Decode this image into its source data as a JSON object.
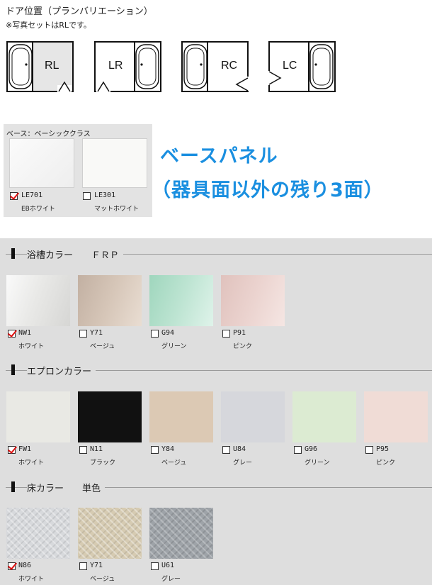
{
  "door": {
    "title": "ドア位置（プランバリエーション）",
    "note": "※写真セットはRLです。",
    "plans": [
      "RL",
      "LR",
      "RC",
      "LC"
    ]
  },
  "base": {
    "subtitle": "ベース：ベーシッククラス",
    "heading_line1": "ベースパネル",
    "heading_line2": "（器具面以外の残り3面）",
    "accent_color": "#1a8fe0",
    "items": [
      {
        "code": "LE701",
        "name": "EBホワイト",
        "checked": true,
        "color": "#f4f4f4"
      },
      {
        "code": "LE301",
        "name": "マットホワイト",
        "checked": false,
        "color": "#f9f9f7"
      }
    ]
  },
  "tub": {
    "label": "浴槽カラー　　ＦＲＰ",
    "items": [
      {
        "code": "NW1",
        "name": "ホワイト",
        "checked": true,
        "color": "#e6e6e4"
      },
      {
        "code": "Y71",
        "name": "ベージュ",
        "checked": false,
        "color": "#c9b8aa"
      },
      {
        "code": "G94",
        "name": "グリーン",
        "checked": false,
        "color": "#b5dfcb"
      },
      {
        "code": "P91",
        "name": "ピンク",
        "checked": false,
        "color": "#e8cfcb"
      }
    ]
  },
  "apron": {
    "label": "エプロンカラー",
    "items": [
      {
        "code": "FW1",
        "name": "ホワイト",
        "checked": true,
        "color": "#e9e9e4"
      },
      {
        "code": "N11",
        "name": "ブラック",
        "checked": false,
        "color": "#111111"
      },
      {
        "code": "Y84",
        "name": "ベージュ",
        "checked": false,
        "color": "#dcc9b4"
      },
      {
        "code": "U84",
        "name": "グレー",
        "checked": false,
        "color": "#d6d7dc"
      },
      {
        "code": "G96",
        "name": "グリーン",
        "checked": false,
        "color": "#dcebd2"
      },
      {
        "code": "P95",
        "name": "ピンク",
        "checked": false,
        "color": "#f0dcd6"
      }
    ]
  },
  "floor": {
    "label": "床カラー　　単色",
    "items": [
      {
        "code": "N86",
        "name": "ホワイト",
        "checked": true,
        "color": "#d7d9dc"
      },
      {
        "code": "Y71",
        "name": "ベージュ",
        "checked": false,
        "color": "#d6cbb2"
      },
      {
        "code": "U61",
        "name": "グレー",
        "checked": false,
        "color": "#9ea3a8"
      }
    ]
  }
}
